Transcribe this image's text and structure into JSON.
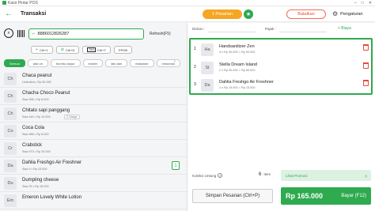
{
  "window": {
    "title": "Kasir Pintar POS"
  },
  "header": {
    "title": "Transaksi",
    "pesanan_label": "1 Pesanan",
    "batalkan_label": "Batalkan",
    "pengaturan_label": "Pengaturan"
  },
  "search": {
    "value": "8886012826287",
    "refresh_label": "Refresh(F5)"
  },
  "shortcuts": [
    {
      "symbol": "+",
      "label": "Ctrl+1"
    },
    {
      "symbol": "⊘",
      "label": "Ctrl+D"
    },
    {
      "symbol": "TAX",
      "label": "Ctrl+T"
    },
    {
      "symbol": "",
      "label": "PPOB"
    }
  ],
  "categories": [
    {
      "label": "Semua",
      "active": true
    },
    {
      "label": "add on",
      "active": false
    },
    {
      "label": "bumbu dapur",
      "active": false
    },
    {
      "label": "eskrim",
      "active": false
    },
    {
      "label": "lain-lain",
      "active": false
    },
    {
      "label": "makanan",
      "active": false
    },
    {
      "label": "minuman",
      "active": false
    }
  ],
  "products": [
    {
      "initials": "Ch",
      "name": "Chaca peanut",
      "meta": "Unlimited • Rp 50.000",
      "badge": "",
      "qty": ""
    },
    {
      "initials": "Ch",
      "name": "Chacha Choco Peanut",
      "meta": "Sisa 996 • Rp 8.000",
      "badge": "",
      "qty": ""
    },
    {
      "initials": "Ch",
      "name": "Chitato sapi panggang",
      "meta": "Sisa 440 • Rp 10.000",
      "badge": "2 Harga",
      "qty": ""
    },
    {
      "initials": "Co",
      "name": "Coca Cola",
      "meta": "Sisa 986 • Rp 8.000",
      "badge": "",
      "qty": ""
    },
    {
      "initials": "Cr",
      "name": "Crabstick",
      "meta": "Sisa 973 • Rp 25.000",
      "badge": "",
      "qty": ""
    },
    {
      "initials": "Da",
      "name": "Dahlia Freshgo Air Freshner",
      "meta": "Sisa 9 • Rp 15.000",
      "badge": "",
      "qty": "1"
    },
    {
      "initials": "Du",
      "name": "Dumpling cheese",
      "meta": "Sisa 93 • Rp 15.000",
      "badge": "",
      "qty": ""
    },
    {
      "initials": "Em",
      "name": "Emeron Lovely White Lotion",
      "meta": "",
      "badge": "",
      "qty": ""
    }
  ],
  "totals_row": {
    "diskon_label": "Diskon :",
    "pajak_label": "Pajak :",
    "biaya_label": "+ Biaya"
  },
  "cart": [
    {
      "num": "1",
      "initials": "Ha",
      "name": "Handsanitizer Zen",
      "meta": "3 x Rp 30.000 = Rp 90.000"
    },
    {
      "num": "2",
      "initials": "St",
      "name": "Stella Dream Island",
      "meta": "2 x Rp 30.000 = Rp 60.000"
    },
    {
      "num": "3",
      "initials": "Da",
      "name": "Dahlia Freshgo Air Freshner",
      "meta": "1 x Rp 15.000 = Rp 15.000"
    }
  ],
  "footer": {
    "koleksi_label": "Koleksi Untung",
    "item_count": "6",
    "item_label": "Item",
    "promo_label": "Lihat Promosi",
    "simpan_label": "Simpan Pesanan (Ctrl+P)",
    "total": "Rp 165.000",
    "bayar_label": "Bayar (F12)"
  },
  "colors": {
    "accent": "#2eaa4f",
    "warning": "#f5a623",
    "danger": "#e74c3c"
  }
}
